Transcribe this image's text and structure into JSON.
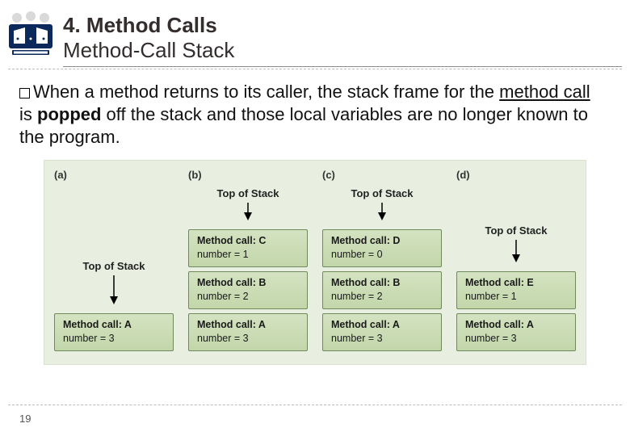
{
  "header": {
    "title1": "4. Method Calls",
    "title2": "Method-Call Stack"
  },
  "body": {
    "lead": "When",
    "seg1": " a method returns to its caller, the stack frame for the ",
    "underlined": "method call",
    "seg2": " is ",
    "bold": "popped",
    "seg3": " off the stack and those local variables are no longer known to the program."
  },
  "diagram": {
    "top_label": "Top of Stack",
    "columns": [
      {
        "label": "(a)",
        "frames": [
          {
            "method": "Method call: A",
            "number": "number = 3"
          }
        ]
      },
      {
        "label": "(b)",
        "frames": [
          {
            "method": "Method call: C",
            "number": "number = 1"
          },
          {
            "method": "Method call: B",
            "number": "number = 2"
          },
          {
            "method": "Method call: A",
            "number": "number = 3"
          }
        ]
      },
      {
        "label": "(c)",
        "frames": [
          {
            "method": "Method call: D",
            "number": "number = 0"
          },
          {
            "method": "Method call: B",
            "number": "number = 2"
          },
          {
            "method": "Method call: A",
            "number": "number = 3"
          }
        ]
      },
      {
        "label": "(d)",
        "frames": [
          {
            "method": "Method call: E",
            "number": "number = 1"
          },
          {
            "method": "Method call: A",
            "number": "number = 3"
          }
        ]
      }
    ]
  },
  "page_number": "19"
}
